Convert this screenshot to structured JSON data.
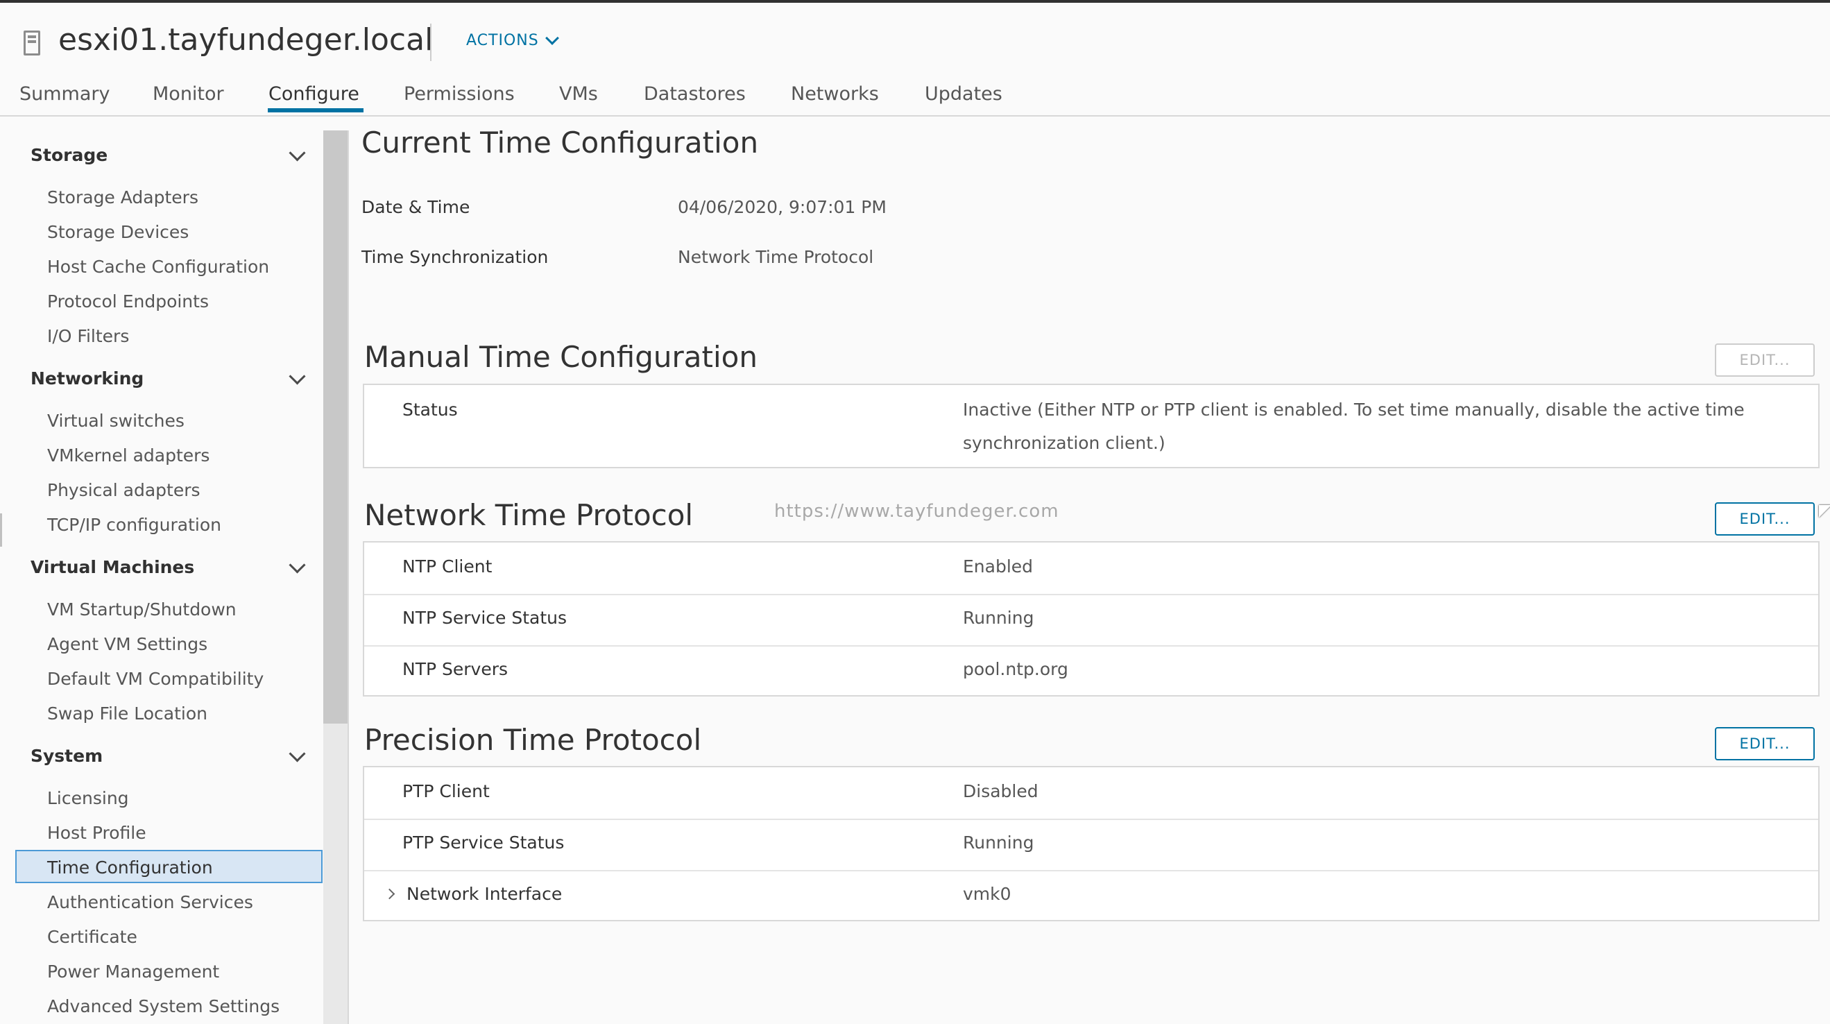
{
  "header": {
    "host_name": "esxi01.tayfundeger.local",
    "actions_label": "ACTIONS"
  },
  "tabs": [
    {
      "label": "Summary"
    },
    {
      "label": "Monitor"
    },
    {
      "label": "Configure",
      "active": true
    },
    {
      "label": "Permissions"
    },
    {
      "label": "VMs"
    },
    {
      "label": "Datastores"
    },
    {
      "label": "Networks"
    },
    {
      "label": "Updates"
    }
  ],
  "sidebar": {
    "sections": [
      {
        "title": "Storage",
        "items": [
          "Storage Adapters",
          "Storage Devices",
          "Host Cache Configuration",
          "Protocol Endpoints",
          "I/O Filters"
        ]
      },
      {
        "title": "Networking",
        "items": [
          "Virtual switches",
          "VMkernel adapters",
          "Physical adapters",
          "TCP/IP configuration"
        ]
      },
      {
        "title": "Virtual Machines",
        "items": [
          "VM Startup/Shutdown",
          "Agent VM Settings",
          "Default VM Compatibility",
          "Swap File Location"
        ]
      },
      {
        "title": "System",
        "items": [
          "Licensing",
          "Host Profile",
          "Time Configuration",
          "Authentication Services",
          "Certificate",
          "Power Management",
          "Advanced System Settings"
        ]
      }
    ],
    "selected_item": "Time Configuration"
  },
  "current_time": {
    "title": "Current Time Configuration",
    "date_label": "Date & Time",
    "date_value": "04/06/2020, 9:07:01 PM",
    "sync_label": "Time Synchronization",
    "sync_value": "Network Time Protocol"
  },
  "manual_time": {
    "title": "Manual Time Configuration",
    "edit_label": "EDIT...",
    "status_label": "Status",
    "status_line1": "Inactive (Either NTP or PTP client is enabled. To set time manually, disable the active time",
    "status_line2": "synchronization client.)"
  },
  "ntp": {
    "title": "Network Time Protocol",
    "edit_label": "EDIT...",
    "watermark": "https://www.tayfundeger.com",
    "rows": [
      {
        "label": "NTP Client",
        "value": "Enabled"
      },
      {
        "label": "NTP Service Status",
        "value": "Running"
      },
      {
        "label": "NTP Servers",
        "value": "pool.ntp.org"
      }
    ]
  },
  "ptp": {
    "title": "Precision Time Protocol",
    "edit_label": "EDIT...",
    "rows": [
      {
        "label": "PTP Client",
        "value": "Disabled"
      },
      {
        "label": "PTP Service Status",
        "value": "Running"
      },
      {
        "label": "Network Interface",
        "value": "vmk0"
      }
    ]
  },
  "colors": {
    "accent": "#0072a3",
    "selection": "#d8e6f4",
    "background": "#fafafa"
  }
}
